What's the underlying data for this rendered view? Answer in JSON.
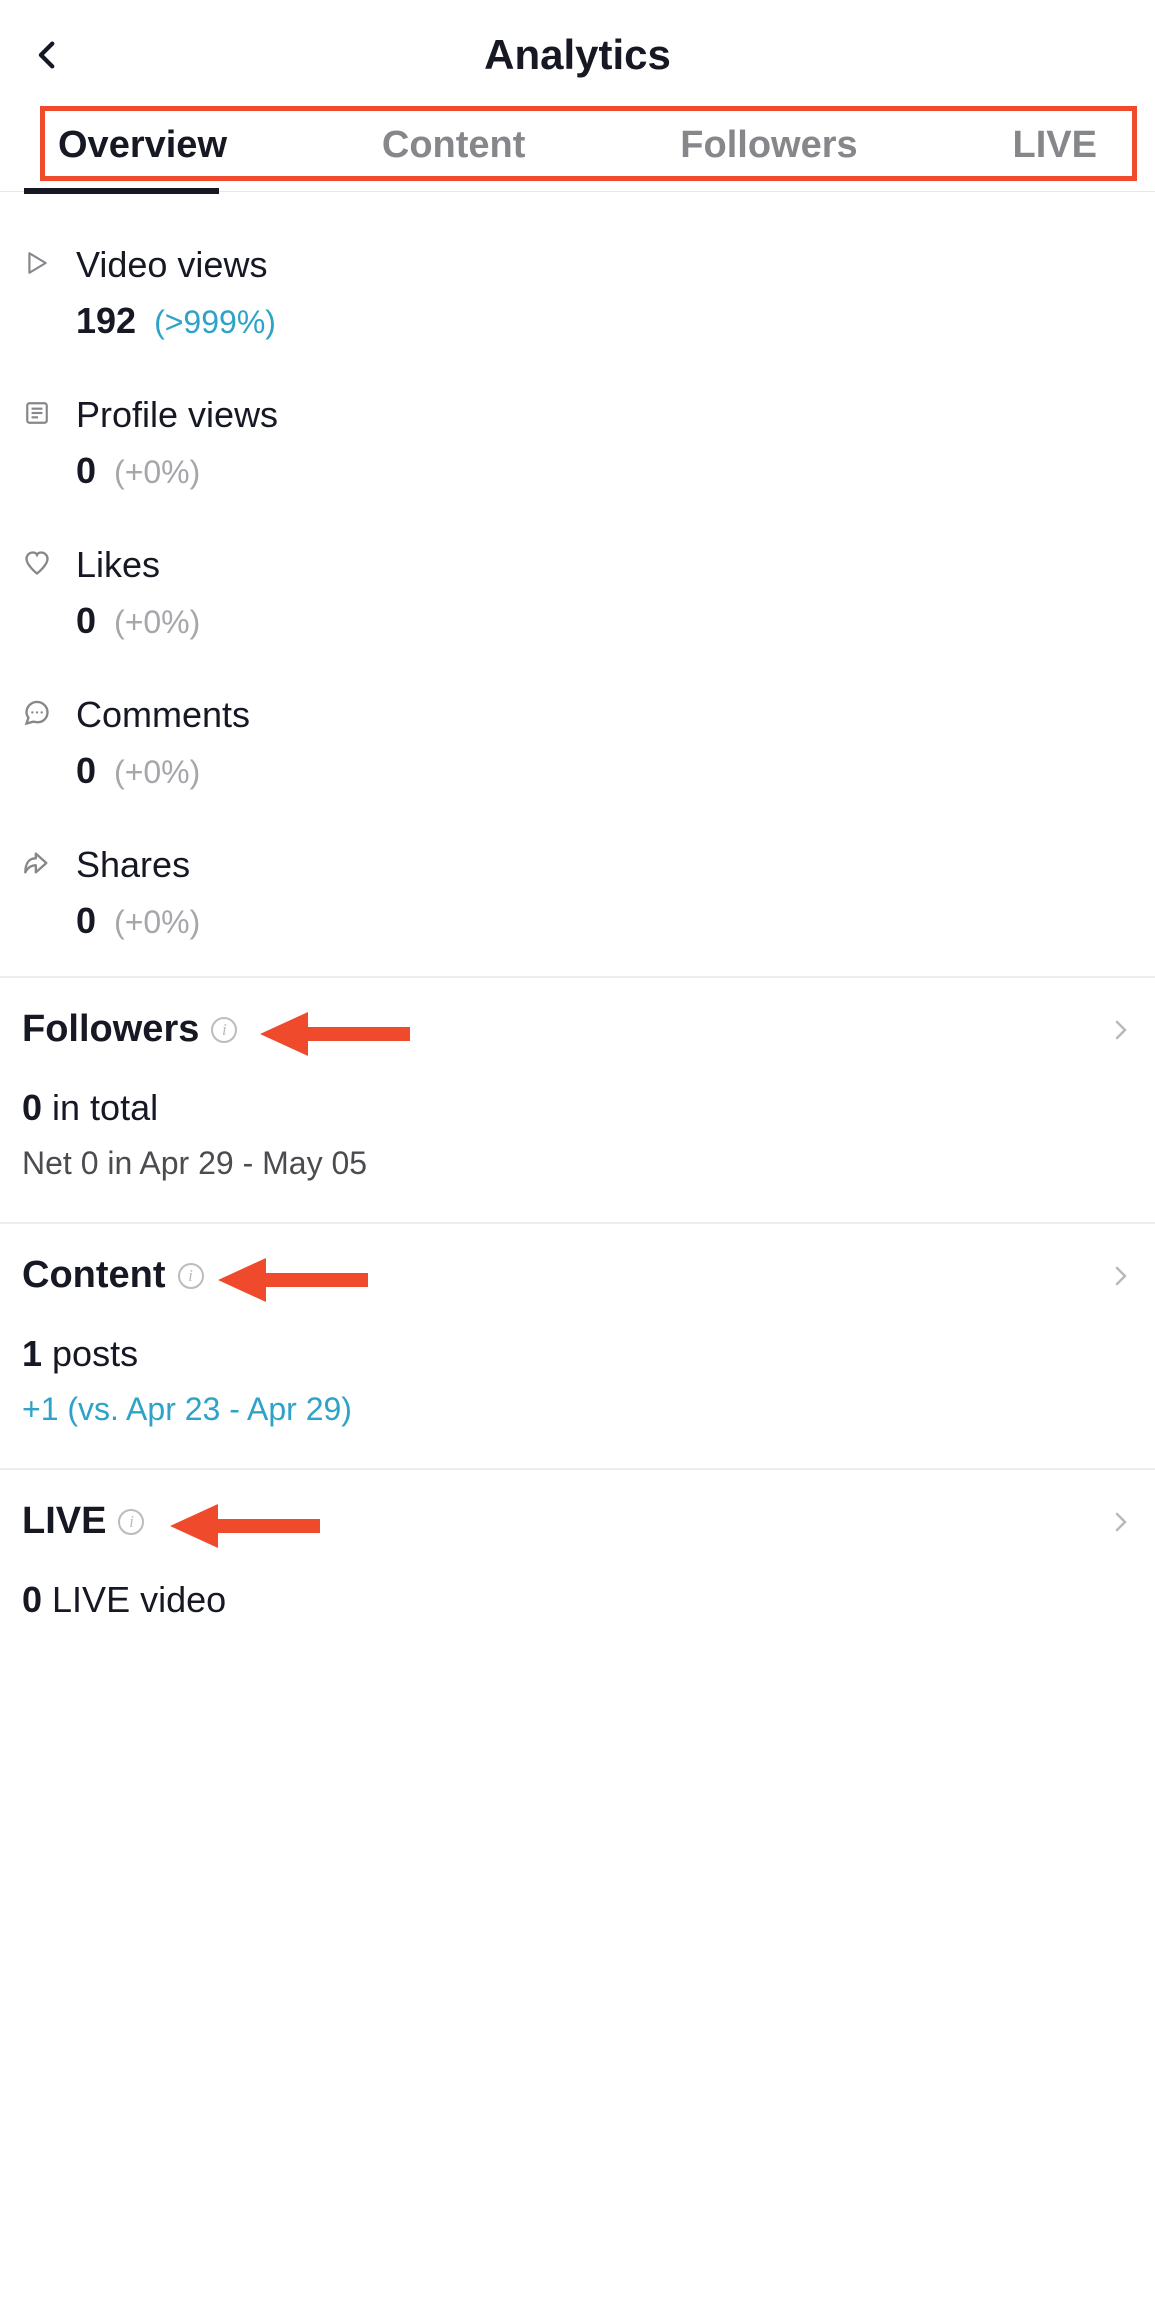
{
  "header": {
    "title": "Analytics"
  },
  "tabs": {
    "overview": "Overview",
    "content": "Content",
    "followers": "Followers",
    "live": "LIVE"
  },
  "metrics": {
    "video_views": {
      "label": "Video views",
      "value": "192",
      "delta": "(>999%)",
      "positive": true
    },
    "profile_views": {
      "label": "Profile views",
      "value": "0",
      "delta": "(+0%)"
    },
    "likes": {
      "label": "Likes",
      "value": "0",
      "delta": "(+0%)"
    },
    "comments": {
      "label": "Comments",
      "value": "0",
      "delta": "(+0%)"
    },
    "shares": {
      "label": "Shares",
      "value": "0",
      "delta": "(+0%)"
    }
  },
  "followers_section": {
    "title": "Followers",
    "total_value": "0",
    "total_suffix": " in total",
    "net": "Net 0 in Apr 29 - May 05"
  },
  "content_section": {
    "title": "Content",
    "posts_value": "1",
    "posts_suffix": " posts",
    "sub": "+1 (vs. Apr 23 - Apr 29)"
  },
  "live_section": {
    "title": "LIVE",
    "value": "0",
    "suffix": " LIVE video"
  },
  "colors": {
    "highlight": "#f04a2c",
    "link": "#2ea3c7",
    "muted": "#a6a7ab"
  }
}
